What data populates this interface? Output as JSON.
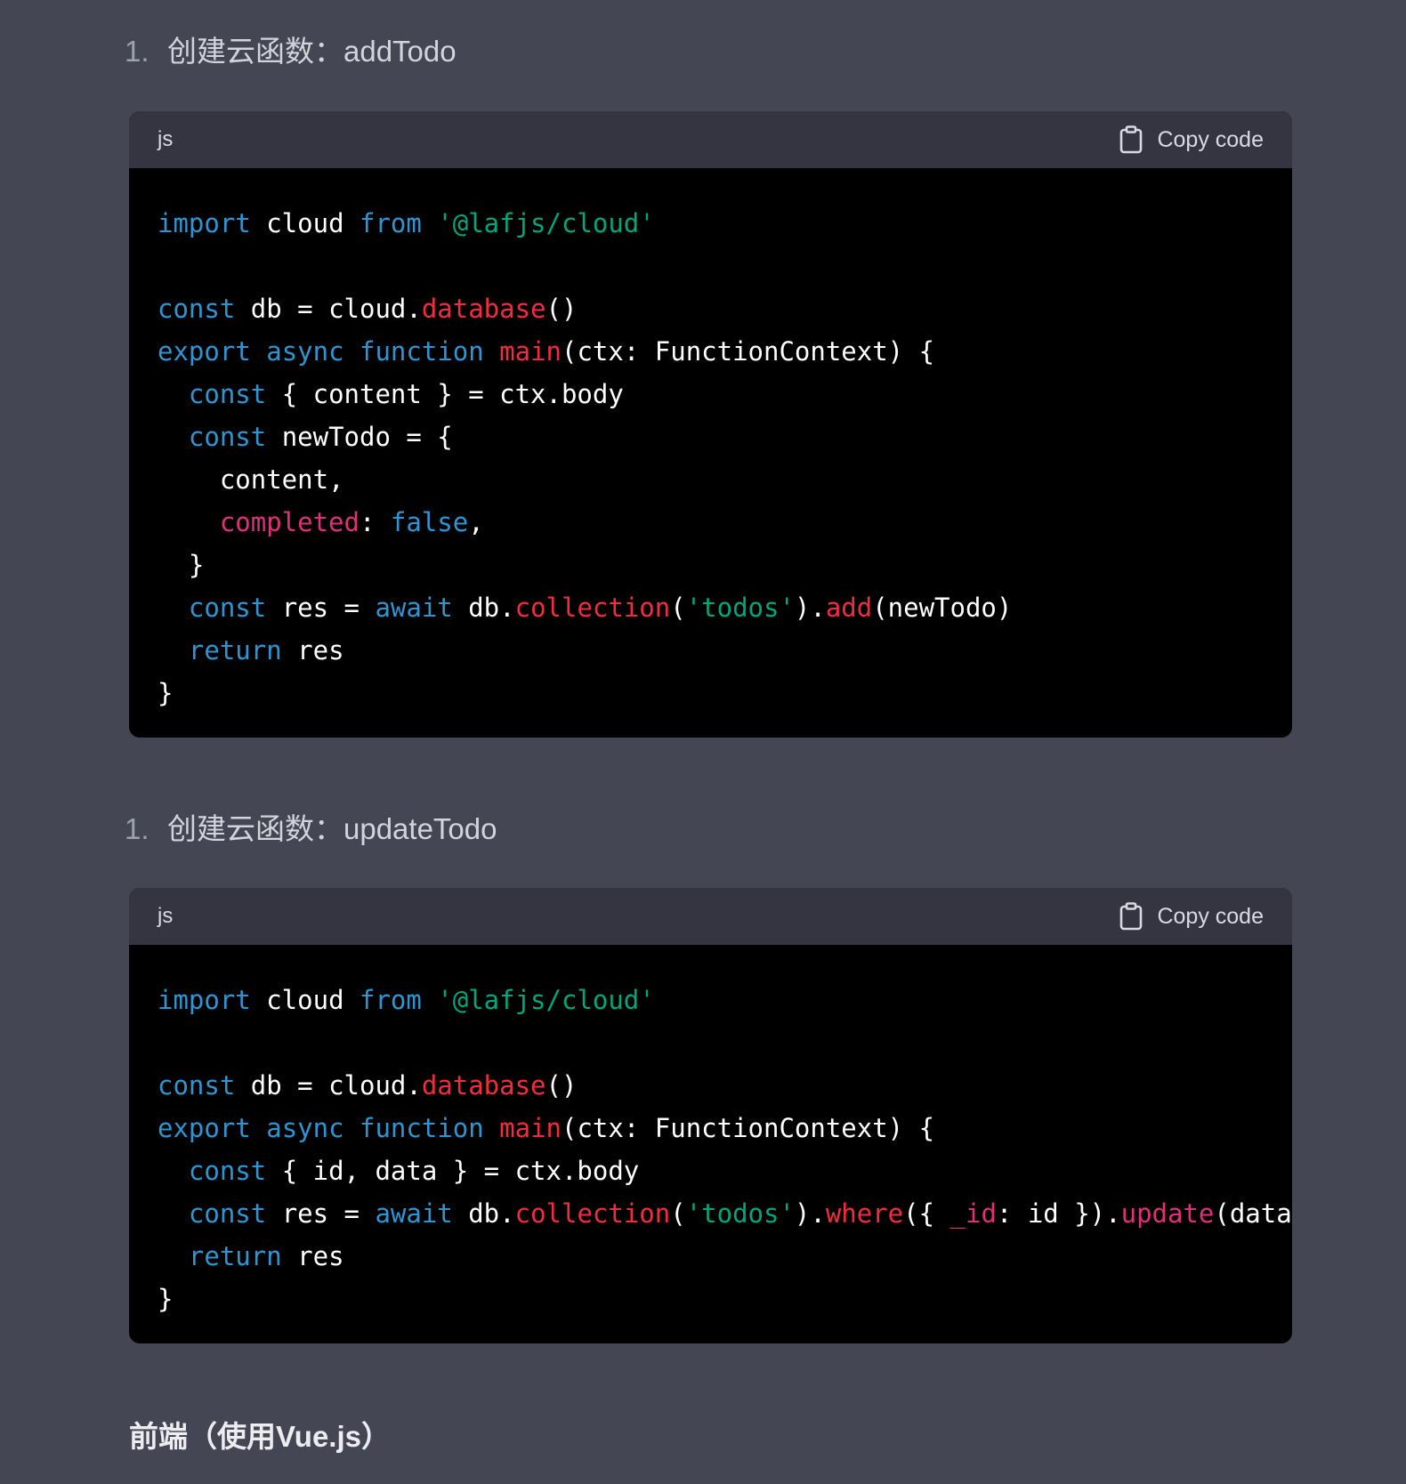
{
  "steps": [
    {
      "number": "1.",
      "label": "创建云函数：addTodo"
    },
    {
      "number": "1.",
      "label": "创建云函数：updateTodo"
    }
  ],
  "blocks": [
    {
      "lang": "js",
      "copy_label": "Copy code",
      "lines": [
        [
          {
            "t": "import",
            "c": "kw"
          },
          {
            "t": " cloud ",
            "c": "plain"
          },
          {
            "t": "from",
            "c": "kw"
          },
          {
            "t": " ",
            "c": "plain"
          },
          {
            "t": "'@lafjs/cloud'",
            "c": "str"
          }
        ],
        [],
        [
          {
            "t": "const",
            "c": "kw"
          },
          {
            "t": " db = cloud.",
            "c": "plain"
          },
          {
            "t": "database",
            "c": "fn"
          },
          {
            "t": "()",
            "c": "plain"
          }
        ],
        [
          {
            "t": "export",
            "c": "kw"
          },
          {
            "t": " ",
            "c": "plain"
          },
          {
            "t": "async",
            "c": "kw"
          },
          {
            "t": " ",
            "c": "plain"
          },
          {
            "t": "function",
            "c": "kw"
          },
          {
            "t": " ",
            "c": "plain"
          },
          {
            "t": "main",
            "c": "fn"
          },
          {
            "t": "(ctx: FunctionContext) {",
            "c": "plain"
          }
        ],
        [
          {
            "t": "  ",
            "c": "plain"
          },
          {
            "t": "const",
            "c": "kw"
          },
          {
            "t": " { content } = ctx.body",
            "c": "plain"
          }
        ],
        [
          {
            "t": "  ",
            "c": "plain"
          },
          {
            "t": "const",
            "c": "kw"
          },
          {
            "t": " newTodo = {",
            "c": "plain"
          }
        ],
        [
          {
            "t": "    content,",
            "c": "plain"
          }
        ],
        [
          {
            "t": "    ",
            "c": "plain"
          },
          {
            "t": "completed",
            "c": "prop"
          },
          {
            "t": ": ",
            "c": "plain"
          },
          {
            "t": "false",
            "c": "kw"
          },
          {
            "t": ",",
            "c": "plain"
          }
        ],
        [
          {
            "t": "  }",
            "c": "plain"
          }
        ],
        [
          {
            "t": "  ",
            "c": "plain"
          },
          {
            "t": "const",
            "c": "kw"
          },
          {
            "t": " res = ",
            "c": "plain"
          },
          {
            "t": "await",
            "c": "kw"
          },
          {
            "t": " db.",
            "c": "plain"
          },
          {
            "t": "collection",
            "c": "fn"
          },
          {
            "t": "(",
            "c": "plain"
          },
          {
            "t": "'todos'",
            "c": "str"
          },
          {
            "t": ").",
            "c": "plain"
          },
          {
            "t": "add",
            "c": "fn"
          },
          {
            "t": "(newTodo)",
            "c": "plain"
          }
        ],
        [
          {
            "t": "  ",
            "c": "plain"
          },
          {
            "t": "return",
            "c": "kw"
          },
          {
            "t": " res",
            "c": "plain"
          }
        ],
        [
          {
            "t": "}",
            "c": "plain"
          }
        ]
      ]
    },
    {
      "lang": "js",
      "copy_label": "Copy code",
      "lines": [
        [
          {
            "t": "import",
            "c": "kw"
          },
          {
            "t": " cloud ",
            "c": "plain"
          },
          {
            "t": "from",
            "c": "kw"
          },
          {
            "t": " ",
            "c": "plain"
          },
          {
            "t": "'@lafjs/cloud'",
            "c": "str"
          }
        ],
        [],
        [
          {
            "t": "const",
            "c": "kw"
          },
          {
            "t": " db = cloud.",
            "c": "plain"
          },
          {
            "t": "database",
            "c": "fn"
          },
          {
            "t": "()",
            "c": "plain"
          }
        ],
        [
          {
            "t": "export",
            "c": "kw"
          },
          {
            "t": " ",
            "c": "plain"
          },
          {
            "t": "async",
            "c": "kw"
          },
          {
            "t": " ",
            "c": "plain"
          },
          {
            "t": "function",
            "c": "kw"
          },
          {
            "t": " ",
            "c": "plain"
          },
          {
            "t": "main",
            "c": "fn"
          },
          {
            "t": "(ctx: FunctionContext) {",
            "c": "plain"
          }
        ],
        [
          {
            "t": "  ",
            "c": "plain"
          },
          {
            "t": "const",
            "c": "kw"
          },
          {
            "t": " { id, data } = ctx.body",
            "c": "plain"
          }
        ],
        [
          {
            "t": "  ",
            "c": "plain"
          },
          {
            "t": "const",
            "c": "kw"
          },
          {
            "t": " res = ",
            "c": "plain"
          },
          {
            "t": "await",
            "c": "kw"
          },
          {
            "t": " db.",
            "c": "plain"
          },
          {
            "t": "collection",
            "c": "fn"
          },
          {
            "t": "(",
            "c": "plain"
          },
          {
            "t": "'todos'",
            "c": "str"
          },
          {
            "t": ").",
            "c": "plain"
          },
          {
            "t": "where",
            "c": "fn"
          },
          {
            "t": "({ ",
            "c": "plain"
          },
          {
            "t": "_id",
            "c": "prop"
          },
          {
            "t": ": id }).",
            "c": "plain"
          },
          {
            "t": "update",
            "c": "prop"
          },
          {
            "t": "(data)",
            "c": "plain"
          }
        ],
        [
          {
            "t": "  ",
            "c": "plain"
          },
          {
            "t": "return",
            "c": "kw"
          },
          {
            "t": " res",
            "c": "plain"
          }
        ],
        [
          {
            "t": "}",
            "c": "plain"
          }
        ]
      ]
    }
  ],
  "heading": "前端（使用Vue.js）",
  "colors": {
    "page_bg": "#444654",
    "header_bg": "#343541",
    "code_bg": "#000000",
    "keyword": "#2e95d3",
    "function": "#f22c3d",
    "string": "#00a67d",
    "property": "#df3079"
  }
}
